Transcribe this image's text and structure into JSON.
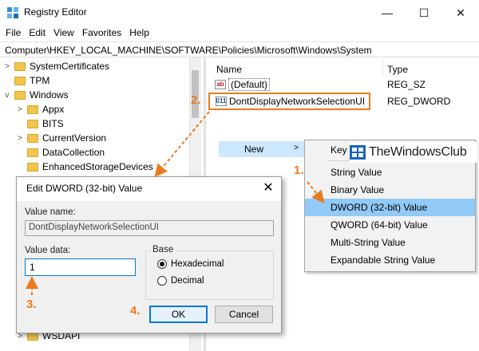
{
  "window": {
    "title": "Registry Editor",
    "icon": "registry-icon",
    "controls": {
      "minimize": "—",
      "maximize": "☐",
      "close": "✕"
    }
  },
  "menubar": {
    "items": [
      "File",
      "Edit",
      "View",
      "Favorites",
      "Help"
    ]
  },
  "address": "Computer\\HKEY_LOCAL_MACHINE\\SOFTWARE\\Policies\\Microsoft\\Windows\\System",
  "tree": {
    "items": [
      {
        "label": "SystemCertificates",
        "chevron": ">"
      },
      {
        "label": "TPM",
        "chevron": ""
      },
      {
        "label": "Windows",
        "chevron": "v"
      },
      {
        "label": "Appx",
        "chevron": ">"
      },
      {
        "label": "BITS",
        "chevron": ""
      },
      {
        "label": "CurrentVersion",
        "chevron": ">"
      },
      {
        "label": "DataCollection",
        "chevron": ""
      },
      {
        "label": "EnhancedStorageDevices",
        "chevron": ""
      },
      {
        "label": "WSDAPI",
        "chevron": ">"
      }
    ]
  },
  "list": {
    "columns": {
      "name": "Name",
      "type": "Type"
    },
    "rows": [
      {
        "name": "(Default)",
        "type": "REG_SZ",
        "icon": "ab"
      },
      {
        "name": "DontDisplayNetworkSelectionUI",
        "type": "REG_DWORD",
        "icon": "011"
      }
    ]
  },
  "context_menu": {
    "new_label": "New",
    "new_arrow": ">",
    "submenu": [
      "Key",
      "String Value",
      "Binary Value",
      "DWORD (32-bit) Value",
      "QWORD (64-bit) Value",
      "Multi-String Value",
      "Expandable String Value"
    ],
    "active_item": "DWORD (32-bit) Value"
  },
  "watermark": {
    "text": "TheWindowsClub"
  },
  "dialog": {
    "title": "Edit DWORD (32-bit) Value",
    "close": "✕",
    "value_name_label": "Value name:",
    "value_name": "DontDisplayNetworkSelectionUI",
    "value_data_label": "Value data:",
    "value_data": "1",
    "base_label": "Base",
    "base_options": [
      "Hexadecimal",
      "Decimal"
    ],
    "base_selected": "Hexadecimal",
    "ok_label": "OK",
    "cancel_label": "Cancel"
  },
  "annotations": {
    "steps": [
      "1.",
      "2.",
      "3.",
      "4."
    ],
    "color": "#ec7b1f"
  },
  "colors": {
    "highlight_blue": "#91c9f7",
    "menu_hover": "#cce8ff",
    "accent": "#0078d7",
    "folder": "#f2c54c"
  }
}
